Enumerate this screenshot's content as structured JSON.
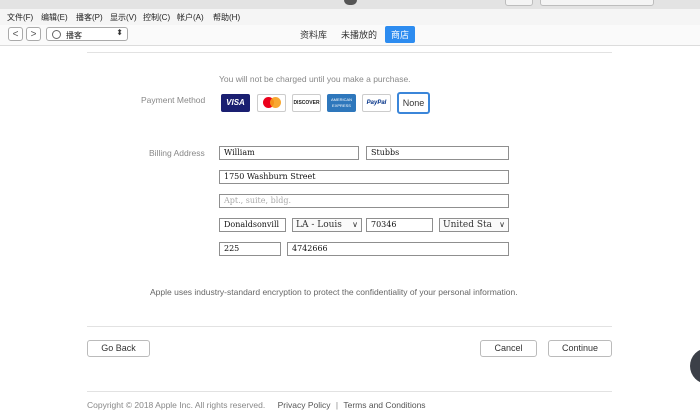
{
  "menu": [
    "文件(F)",
    "编辑(E)",
    "播客(P)",
    "显示(V)",
    "控制(C)",
    "帐户(A)",
    "帮助(H)"
  ],
  "nav": {
    "back": "<",
    "forward": ">",
    "library_select": "播客",
    "tabs": [
      "资料库",
      "未播放的",
      "商店"
    ]
  },
  "notice": "You will not be charged until you make a purchase.",
  "payment": {
    "label": "Payment Method",
    "cards": [
      "VISA",
      "MasterCard",
      "DISCOVER",
      "AMERICAN EXPRESS",
      "PayPal",
      "None"
    ],
    "selected": "None"
  },
  "billing": {
    "label": "Billing Address",
    "first_name": "William",
    "last_name": "Stubbs",
    "street": "1750 Washburn Street",
    "apt_placeholder": "Apt., suite, bldg.",
    "city": "Donaldsonvill",
    "state": "LA - Louis",
    "zip": "70346",
    "country": "United Sta",
    "area_code": "225",
    "phone": "4742666"
  },
  "encryption_note": "Apple uses industry-standard encryption to protect the confidentiality of your personal information.",
  "buttons": {
    "go_back": "Go Back",
    "cancel": "Cancel",
    "continue": "Continue"
  },
  "footer": {
    "copyright": "Copyright © 2018 Apple Inc. All rights reserved.",
    "privacy": "Privacy Policy",
    "sep": "|",
    "terms": "Terms and Conditions"
  },
  "colors": {
    "accent": "#2d8cf0",
    "visa": "#1a1f71",
    "amex": "#2e77bc",
    "selected_border": "#3b86d9"
  }
}
